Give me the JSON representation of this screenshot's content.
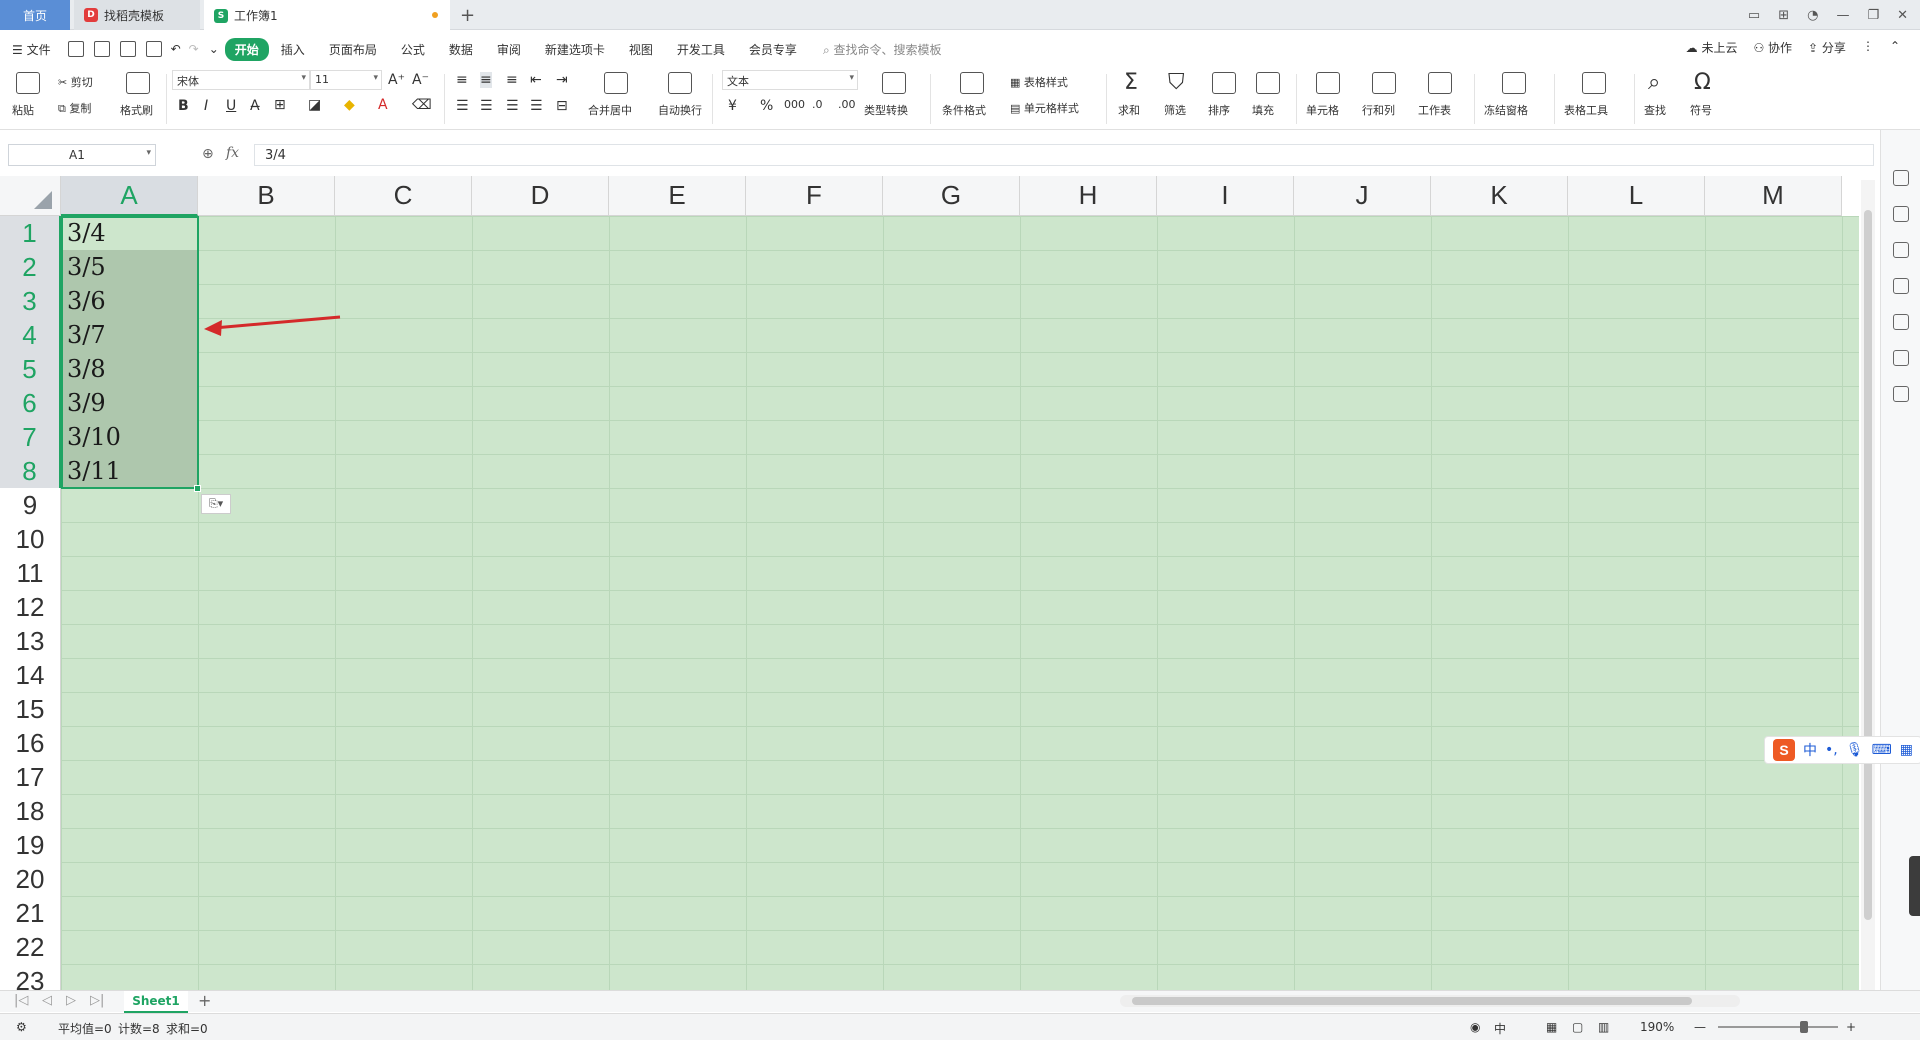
{
  "tabs": {
    "home": "首页",
    "template": "找稻壳模板",
    "workbook": "工作簿1",
    "add": "+"
  },
  "menu": {
    "file": "文件",
    "items": [
      "开始",
      "插入",
      "页面布局",
      "公式",
      "数据",
      "审阅",
      "新建选项卡",
      "视图",
      "开发工具",
      "会员专享"
    ],
    "active_index": 0,
    "search": "查找命令、搜索模板",
    "cloud": "未上云",
    "collab": "协作",
    "share": "分享"
  },
  "ribbon": {
    "paste": "粘贴",
    "cut": "剪切",
    "copy": "复制",
    "format_painter": "格式刷",
    "font_name": "宋体",
    "font_size": "11",
    "number_format": "文本",
    "merge_center": "合并居中",
    "wrap": "自动换行",
    "type_convert": "类型转换",
    "cond_format": "条件格式",
    "table_style": "表格样式",
    "cell_style": "单元格样式",
    "sum": "求和",
    "filter": "筛选",
    "sort": "排序",
    "fill": "填充",
    "cell": "单元格",
    "row_col": "行和列",
    "worksheet": "工作表",
    "freeze": "冻结窗格",
    "table_tools": "表格工具",
    "find": "查找",
    "symbol": "符号"
  },
  "formula_bar": {
    "name_box": "A1",
    "fx": "fx",
    "content": "3/4"
  },
  "grid": {
    "columns": [
      "A",
      "B",
      "C",
      "D",
      "E",
      "F",
      "G",
      "H",
      "I",
      "J",
      "K",
      "L",
      "M"
    ],
    "rows": [
      "1",
      "2",
      "3",
      "4",
      "5",
      "6",
      "7",
      "8",
      "9",
      "10",
      "11",
      "12",
      "13",
      "14",
      "15",
      "16",
      "17",
      "18",
      "19",
      "20",
      "21",
      "22",
      "23"
    ],
    "column_a_values": [
      "3/4",
      "3/5",
      "3/6",
      "3/7",
      "3/8",
      "3/9",
      "3/10",
      "3/11"
    ],
    "cell_bg": "#cde6cc",
    "selection_color": "#1fa463"
  },
  "sheet_tabs": {
    "active": "Sheet1"
  },
  "status": {
    "average": "平均值=0",
    "count": "计数=8",
    "sum": "求和=0",
    "zoom": "190%",
    "lang": "中"
  },
  "ime": {
    "lang": "中"
  },
  "annotation": {
    "color": "#d42a2a"
  }
}
